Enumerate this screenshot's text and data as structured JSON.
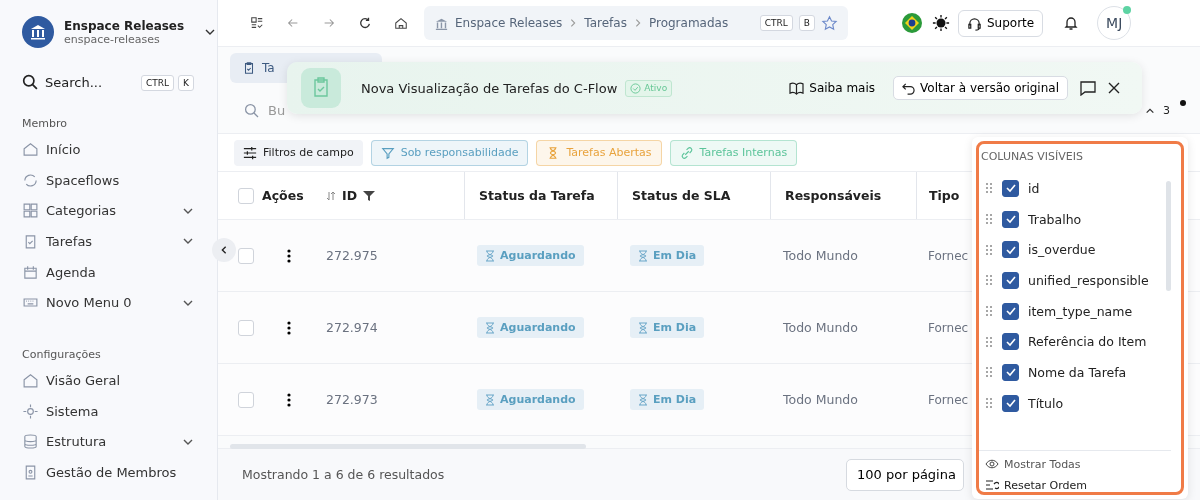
{
  "workspace": {
    "name": "Enspace Releases",
    "slug": "enspace-releases"
  },
  "sidebar": {
    "search": {
      "label": "Search...",
      "keys": [
        "CTRL",
        "K"
      ]
    },
    "sections": [
      {
        "title": "Membro",
        "items": [
          {
            "label": "Início",
            "expandable": false
          },
          {
            "label": "Spaceflows",
            "expandable": false
          },
          {
            "label": "Categorias",
            "expandable": true
          },
          {
            "label": "Tarefas",
            "expandable": true
          },
          {
            "label": "Agenda",
            "expandable": false
          },
          {
            "label": "Novo Menu 0",
            "expandable": true
          }
        ]
      },
      {
        "title": "Configurações",
        "items": [
          {
            "label": "Visão Geral",
            "expandable": false
          },
          {
            "label": "Sistema",
            "expandable": false
          },
          {
            "label": "Estrutura",
            "expandable": true
          },
          {
            "label": "Gestão de Membros",
            "expandable": false
          }
        ]
      }
    ]
  },
  "breadcrumb": {
    "items": [
      "Enspace Releases",
      "Tarefas",
      "Programadas"
    ],
    "keys": [
      "CTRL",
      "B"
    ]
  },
  "topbar": {
    "support": "Suporte",
    "avatar": "MJ"
  },
  "tab": {
    "label": "Ta",
    "selected": true
  },
  "search": {
    "placeholder": "Bu"
  },
  "banner": {
    "title": "Nova Visualização de Tarefas do C-Flow",
    "badge": "Ativo",
    "learn_more": "Saiba mais",
    "revert": "Voltar à versão original"
  },
  "counter": "3",
  "filters": {
    "field_filters": "Filtros de campo",
    "chips": [
      {
        "label": "Sob responsabilidade",
        "color": "#5a9fc0"
      },
      {
        "label": "Tarefas Abertas",
        "color": "#e8a33d"
      },
      {
        "label": "Tarefas Internas",
        "color": "#5cc49a"
      }
    ]
  },
  "table": {
    "select_all_checked": false,
    "columns": [
      "Ações",
      "ID",
      "Status da Tarefa",
      "Status de SLA",
      "Responsáveis",
      "Tipo"
    ],
    "rows": [
      {
        "checked": false,
        "id": "272.975",
        "status": "Aguardando",
        "sla": "Em Dia",
        "responsible": "Todo Mundo",
        "type": "Fornec"
      },
      {
        "checked": false,
        "id": "272.974",
        "status": "Aguardando",
        "sla": "Em Dia",
        "responsible": "Todo Mundo",
        "type": "Fornec"
      },
      {
        "checked": false,
        "id": "272.973",
        "status": "Aguardando",
        "sla": "Em Dia",
        "responsible": "Todo Mundo",
        "type": "Fornec"
      }
    ]
  },
  "footer": {
    "summary": "Mostrando 1 a 6 de 6 resultados",
    "per_page": "100 por página"
  },
  "column_menu": {
    "title": "COLUNAS VISÍVEIS",
    "columns": [
      {
        "label": "id",
        "checked": true
      },
      {
        "label": "Trabalho",
        "checked": true
      },
      {
        "label": "is_overdue",
        "checked": true
      },
      {
        "label": "unified_responsible",
        "checked": true
      },
      {
        "label": "item_type_name",
        "checked": true
      },
      {
        "label": "Referência do Item",
        "checked": true
      },
      {
        "label": "Nome da Tarefa",
        "checked": true
      },
      {
        "label": "Título",
        "checked": true
      }
    ],
    "show_all": "Mostrar Todas",
    "reset": "Resetar Ordem"
  }
}
